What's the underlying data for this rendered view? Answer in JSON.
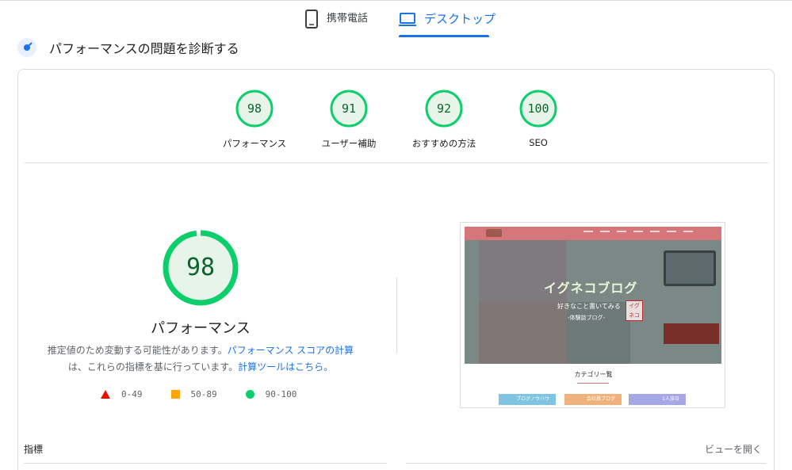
{
  "device_tabs": {
    "mobile_label": "携帯電話",
    "desktop_label": "デスクトップ",
    "active": "desktop"
  },
  "section": {
    "title": "パフォーマンスの問題を診断する",
    "icon": "performance-icon"
  },
  "categories": [
    {
      "score": "98",
      "label": "パフォーマンス"
    },
    {
      "score": "91",
      "label": "ユーザー補助"
    },
    {
      "score": "92",
      "label": "おすすめの方法"
    },
    {
      "score": "100",
      "label": "SEO"
    }
  ],
  "main_gauge": {
    "score": "98",
    "label": "パフォーマンス",
    "desc_line1": "推定値のため変動する可能性があります。",
    "link1": "パフォーマンス スコアの計算",
    "desc_line2": "は、これらの指標を基に行っています。",
    "link2": "計算ツールはこちら。"
  },
  "legend": [
    {
      "range": "0-49",
      "shape": "triangle",
      "color": "#eb0f00"
    },
    {
      "range": "50-89",
      "shape": "square",
      "color": "#ffa400"
    },
    {
      "range": "90-100",
      "shape": "circle",
      "color": "#0cce6b"
    }
  ],
  "screenshot_preview": {
    "site_title": "イグネコブログ",
    "tagline": "好きなこと書いてみる",
    "subtitle": "-体験談ブログ-",
    "stamp": "イグネコ",
    "section_heading": "カテゴリー覧",
    "buttons": [
      "ブログノウハウ",
      "会社員ブログ",
      "1人旅日"
    ]
  },
  "footer": {
    "metrics_label": "指標",
    "view_toggle": "ビューを開く"
  },
  "colors": {
    "accent": "#1a73e8",
    "pass_green": "#0cce6b",
    "pass_text": "#0d652d",
    "pass_fill": "#e6f4ea"
  }
}
